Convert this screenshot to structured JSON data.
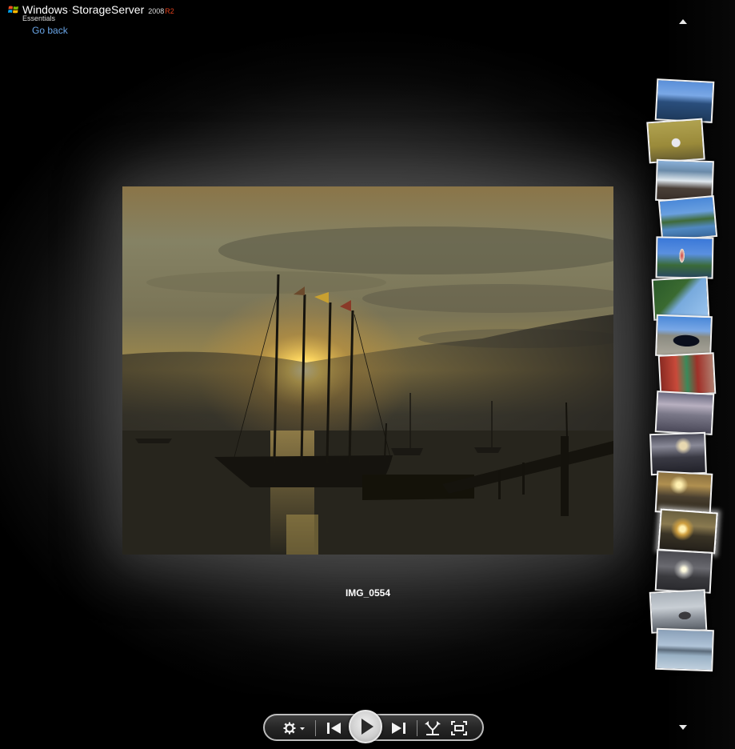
{
  "header": {
    "brand_windows": "Windows",
    "brand_product": "StorageServer",
    "brand_year": "2008",
    "brand_release": "R2",
    "brand_edition": "Essentials",
    "go_back_label": "Go back"
  },
  "photo": {
    "caption": "IMG_0554",
    "description": "Sunset over harbor with tall ship silhouette and pier"
  },
  "thumbnails": [
    {
      "name": "coastline-bay",
      "selected": false
    },
    {
      "name": "person-in-hat-meadow",
      "selected": false
    },
    {
      "name": "rocky-shore-waves",
      "selected": false
    },
    {
      "name": "lake-house-reflection",
      "selected": false
    },
    {
      "name": "lighthouse-playground",
      "selected": false
    },
    {
      "name": "tree-sky-rotated",
      "selected": false
    },
    {
      "name": "black-car-parking",
      "selected": false
    },
    {
      "name": "boat-interior-red",
      "selected": false
    },
    {
      "name": "grey-sea-dusk",
      "selected": false
    },
    {
      "name": "tall-ship-overcast",
      "selected": false
    },
    {
      "name": "harbor-sunset-pier",
      "selected": false
    },
    {
      "name": "IMG_0554",
      "selected": true
    },
    {
      "name": "sun-over-water",
      "selected": false
    },
    {
      "name": "rock-on-beach-fog",
      "selected": false
    },
    {
      "name": "foggy-shoreline",
      "selected": false
    }
  ],
  "controls": {
    "settings": "settings-icon",
    "previous": "previous-icon",
    "play": "play-icon",
    "next": "next-icon",
    "shuffle": "shuffle-icon",
    "fullscreen": "fullscreen-icon"
  },
  "scroll": {
    "up": "scroll-up-arrow",
    "down": "scroll-down-arrow"
  },
  "colors": {
    "link": "#6aa6e8",
    "r2_accent": "#e0401c"
  }
}
